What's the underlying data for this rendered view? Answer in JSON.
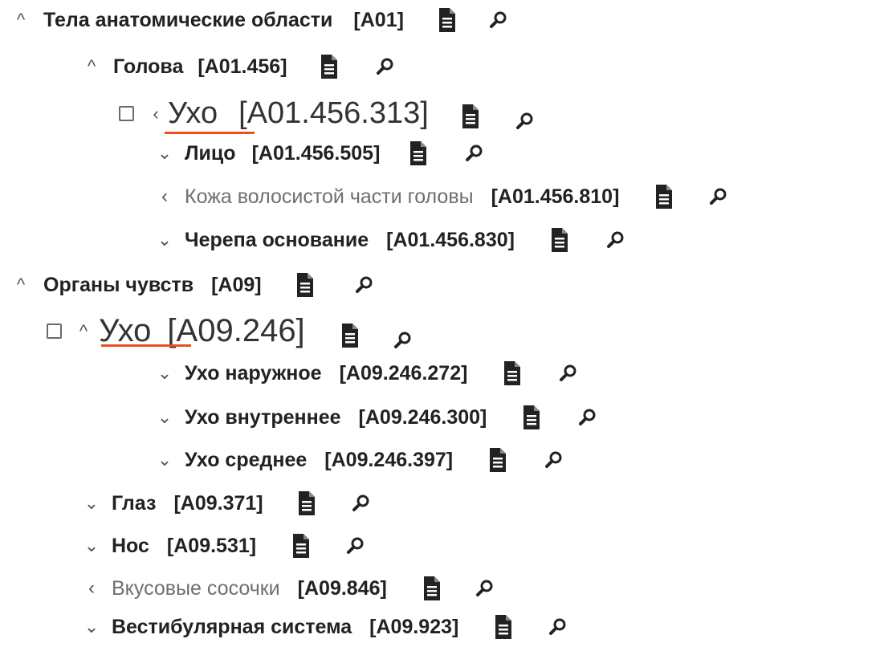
{
  "accent_underline": "#e9501e",
  "icons": {
    "document": "document-icon",
    "search": "search-icon",
    "expanded": "chevron-up-icon",
    "collapsed": "chevron-down-icon",
    "leaf": "chevron-left-icon"
  },
  "tree": [
    {
      "label": "Тела анатомические области",
      "code": "[A01]"
    },
    {
      "label": "Голова",
      "code": "[A01.456]"
    },
    {
      "label": "Ухо",
      "code": "[A01.456.313]"
    },
    {
      "label": "Лицо",
      "code": "[A01.456.505]"
    },
    {
      "label": "Кожа волосистой части головы",
      "code": "[A01.456.810]"
    },
    {
      "label": "Черепа основание",
      "code": "[A01.456.830]"
    },
    {
      "label": "Органы чувств",
      "code": "[A09]"
    },
    {
      "label": "Ухо",
      "code": "[A09.246]"
    },
    {
      "label": "Ухо наружное",
      "code": "[A09.246.272]"
    },
    {
      "label": "Ухо внутреннее",
      "code": "[A09.246.300]"
    },
    {
      "label": "Ухо среднее",
      "code": "[A09.246.397]"
    },
    {
      "label": "Глаз",
      "code": "[A09.371]"
    },
    {
      "label": "Нос",
      "code": "[A09.531]"
    },
    {
      "label": "Вкусовые сосочки",
      "code": "[A09.846]"
    },
    {
      "label": "Вестибулярная система",
      "code": "[A09.923]"
    }
  ]
}
